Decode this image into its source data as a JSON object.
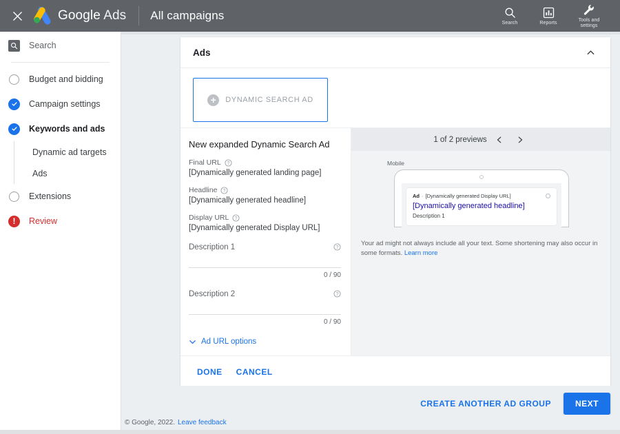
{
  "topbar": {
    "close_icon": "close-icon",
    "brand_primary": "Google",
    "brand_secondary": "Ads",
    "page_title": "All campaigns",
    "actions": [
      {
        "icon": "search-icon",
        "label": "Search"
      },
      {
        "icon": "reports-bar-chart-icon",
        "label": "Reports"
      },
      {
        "icon": "wrench-tools-icon",
        "label": "Tools and\nsettings",
        "label_line1": "Tools and",
        "label_line2": "settings"
      }
    ],
    "bg_color": "#5f6368"
  },
  "sidebar": {
    "search": {
      "label": "Search",
      "icon": "search-box-icon"
    },
    "steps": [
      {
        "label": "Budget and bidding",
        "state": "pending",
        "icon": "empty-circle-icon"
      },
      {
        "label": "Campaign settings",
        "state": "complete",
        "icon": "check-circle-icon"
      },
      {
        "label": "Keywords and ads",
        "state": "complete",
        "active": true,
        "icon": "check-circle-icon"
      }
    ],
    "substeps": [
      {
        "label": "Dynamic ad targets"
      },
      {
        "label": "Ads"
      }
    ],
    "steps_after": [
      {
        "label": "Extensions",
        "state": "pending",
        "icon": "empty-circle-icon"
      },
      {
        "label": "Review",
        "state": "error",
        "icon": "error-circle-icon"
      }
    ],
    "accent_complete": "#1a73e8",
    "accent_error": "#d32f2f"
  },
  "card": {
    "title": "Ads",
    "collapse_icon": "chevron-up-icon",
    "ad_type_button": {
      "label": "Dynamic search ad",
      "display_label": "DYNAMIC SEARCH AD",
      "icon": "plus-circle-icon",
      "border_color": "#1a73e8"
    },
    "form": {
      "title": "New expanded Dynamic Search Ad",
      "fields": [
        {
          "label": "Final URL",
          "value": "[Dynamically generated landing page]",
          "help": "help-icon"
        },
        {
          "label": "Headline",
          "value": "[Dynamically generated headline]",
          "help": "help-icon"
        },
        {
          "label": "Display URL",
          "value": "[Dynamically generated Display URL]",
          "help": "help-icon"
        }
      ],
      "descriptions": [
        {
          "placeholder": "Description 1",
          "counter": "0 / 90",
          "help": "help-icon"
        },
        {
          "placeholder": "Description 2",
          "counter": "0 / 90",
          "help": "help-icon"
        }
      ],
      "ad_url_options": {
        "label": "Ad URL options",
        "icon": "chevron-down-icon"
      }
    },
    "preview": {
      "counter": "1 of 2 previews",
      "prev_icon": "chevron-left-icon",
      "next_icon": "chevron-right-icon",
      "device_label": "Mobile",
      "ad": {
        "badge": "Ad",
        "separator": "·",
        "display_url": "[Dynamically generated Display URL]",
        "headline": "[Dynamically generated headline]",
        "description": "Description 1",
        "info_icon": "info-dot-icon"
      },
      "disclaimer": "Your ad might not always include all your text. Some shortening may also occur in some formats.",
      "learn_more": "Learn more"
    },
    "actions": {
      "done": "DONE",
      "cancel": "CANCEL"
    }
  },
  "bottom": {
    "create_another": "CREATE ANOTHER AD GROUP",
    "next": "NEXT",
    "next_color": "#1a73e8"
  },
  "footer": {
    "copyright": "© Google, 2022.",
    "feedback": "Leave feedback"
  }
}
